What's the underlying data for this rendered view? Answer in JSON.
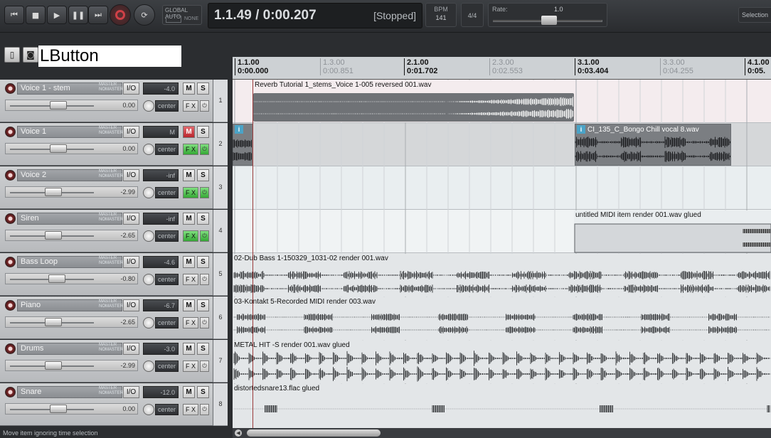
{
  "transport": {
    "buttons": [
      "go-to-start",
      "stop",
      "play",
      "pause",
      "go-to-end",
      "record",
      "repeat"
    ],
    "global_auto_label": "GLOBAL AUTO",
    "global_auto_value": "NONE",
    "position": "1.1.49 / 0:00.207",
    "state": "[Stopped]",
    "bpm_label": "BPM",
    "bpm_value": "141",
    "time_signature": "4/4",
    "rate_label": "Rate:",
    "rate_value": "1.0",
    "rate_level": 0.5,
    "selection_label": "Selection"
  },
  "toolbar": {
    "overlay_text": "LButton"
  },
  "ruler": [
    {
      "bar": "1.1.00",
      "time": "0:00.000",
      "major": true
    },
    {
      "bar": "1.3.00",
      "time": "0:00.851",
      "major": false
    },
    {
      "bar": "2.1.00",
      "time": "0:01.702",
      "major": true
    },
    {
      "bar": "2.3.00",
      "time": "0:02.553",
      "major": false
    },
    {
      "bar": "3.1.00",
      "time": "0:03.404",
      "major": true
    },
    {
      "bar": "3.3.00",
      "time": "0:04.255",
      "major": false
    },
    {
      "bar": "4.1.00",
      "time": "0:05.",
      "major": true
    }
  ],
  "master_label": "MASTER",
  "master_sub": "NOMASTER",
  "io_label": "I/O",
  "mute_label": "M",
  "solo_label": "S",
  "fx_label": "F X",
  "tracks": [
    {
      "name": "Voice 1 - stem",
      "number": "1",
      "volume": "-4.0",
      "fader_db": "0.00",
      "fader_pos": 0.58,
      "pan": "center",
      "muted": false,
      "fx_on": false
    },
    {
      "name": "Voice 1",
      "number": "2",
      "volume": "M",
      "fader_db": "0.00",
      "fader_pos": 0.58,
      "pan": "center",
      "muted": true,
      "fx_on": true
    },
    {
      "name": "Voice 2",
      "number": "3",
      "volume": "-inf",
      "fader_db": "-2.99",
      "fader_pos": 0.52,
      "pan": "center",
      "muted": false,
      "fx_on": true
    },
    {
      "name": "Siren",
      "number": "4",
      "volume": "-inf",
      "fader_db": "-2.65",
      "fader_pos": 0.52,
      "pan": "center",
      "muted": false,
      "fx_on": true
    },
    {
      "name": "Bass Loop",
      "number": "5",
      "volume": "-4.6",
      "fader_db": "-0.80",
      "fader_pos": 0.56,
      "pan": "center",
      "muted": false,
      "fx_on": false
    },
    {
      "name": "Piano",
      "number": "6",
      "volume": "-6.7",
      "fader_db": "-2.65",
      "fader_pos": 0.52,
      "pan": "center",
      "muted": false,
      "fx_on": false
    },
    {
      "name": "Drums",
      "number": "7",
      "volume": "-3.0",
      "fader_db": "-2.99",
      "fader_pos": 0.52,
      "pan": "center",
      "muted": false,
      "fx_on": false
    },
    {
      "name": "Snare",
      "number": "8",
      "volume": "-12.0",
      "fader_db": "0.00",
      "fader_pos": 0.58,
      "pan": "center",
      "muted": false,
      "fx_on": false
    }
  ],
  "items": {
    "reverb_tutorial": "Reverb Tutorial 1_stems_Voice 1-005 reversed 001.wav",
    "bongo": "CI_135_C_Bongo Chill vocal 8.wav",
    "midi_glued": "untitled MIDI item render 001.wav glued",
    "dub_bass": "02-Dub Bass 1-150329_1031-02 render 001.wav",
    "kontakt": "03-Kontakt 5-Recorded MIDI render 003.wav",
    "metal_hit": "METAL HIT -S render 001.wav glued",
    "snare": "distortedsnare13.flac glued"
  },
  "status": "Move item ignoring time selection"
}
